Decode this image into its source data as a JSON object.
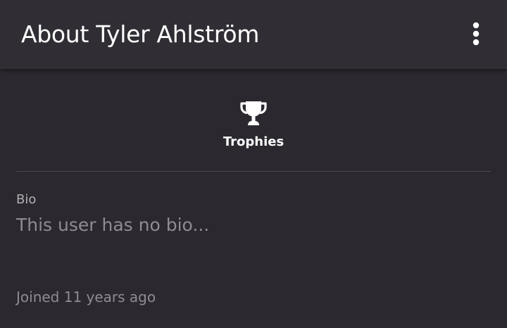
{
  "header": {
    "title": "About Tyler Ahlström",
    "menu_icon": "more-vertical-icon"
  },
  "trophies": {
    "icon": "trophy-icon",
    "label": "Trophies"
  },
  "bio": {
    "label": "Bio",
    "text": "This user has no bio..."
  },
  "joined": "Joined 11 years ago",
  "colors": {
    "background": "#2b292f",
    "appbar": "#302e34",
    "primary_text": "#ffffff",
    "secondary_text": "#8e8c92"
  }
}
